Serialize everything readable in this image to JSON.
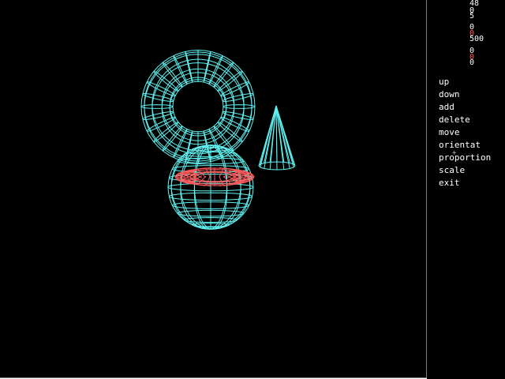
{
  "colors": {
    "background": "#000000",
    "wireframe_primary": "#5ff0f0",
    "wireframe_selected": "#ff5a5a",
    "readout_white": "#ffffff",
    "readout_red": "#ff5a5a",
    "menu_text": "#ffffff"
  },
  "readouts": [
    {
      "value": "48",
      "color": "#ffffff"
    },
    {
      "value": "0",
      "color": "#ffffff"
    },
    {
      "value": "5",
      "color": "#ffffff"
    },
    {
      "value": "0",
      "color": "#ffffff"
    },
    {
      "value": "0",
      "color": "#ff5a5a"
    },
    {
      "value": "500",
      "color": "#ffffff"
    },
    {
      "value": "0",
      "color": "#ffffff"
    },
    {
      "value": "0",
      "color": "#ff5a5a"
    },
    {
      "value": "0",
      "color": "#ffffff"
    }
  ],
  "menu": {
    "items": [
      {
        "id": "up",
        "label": "up"
      },
      {
        "id": "down",
        "label": "down"
      },
      {
        "id": "add",
        "label": "add"
      },
      {
        "id": "delete",
        "label": "delete"
      },
      {
        "id": "move",
        "label": "move"
      },
      {
        "id": "orientat",
        "label": "orientat"
      },
      {
        "id": "proportion",
        "label": "proportion"
      },
      {
        "id": "scale",
        "label": "scale"
      },
      {
        "id": "exit",
        "label": "exit"
      }
    ]
  },
  "scene": {
    "objects": [
      {
        "type": "torus",
        "selected": false
      },
      {
        "type": "cone",
        "selected": false
      },
      {
        "type": "sphere",
        "selected": false
      },
      {
        "type": "flat-ring",
        "selected": true
      }
    ]
  },
  "cursor_icon": "crosshair-icon"
}
